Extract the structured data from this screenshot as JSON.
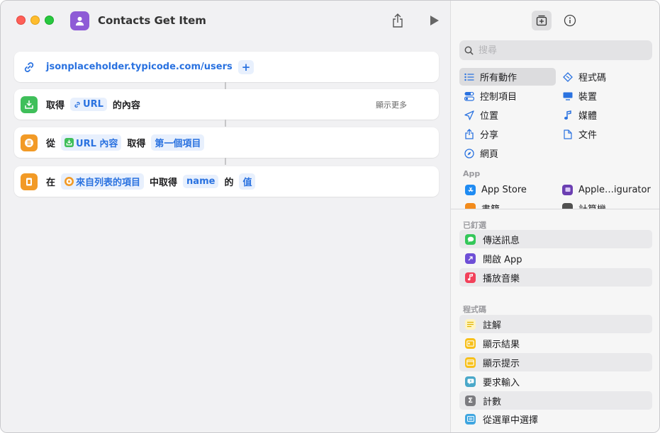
{
  "window": {
    "title": "Contacts Get Item"
  },
  "editor": {
    "actions": [
      {
        "url": "jsonplaceholder.typicode.com/users",
        "plus": "+"
      },
      {
        "verb": "取得",
        "param": "URL",
        "suffix": "的內容",
        "show_more": "顯示更多"
      },
      {
        "from": "從",
        "param": "URL 內容",
        "verb": "取得",
        "value": "第一個項目"
      },
      {
        "in": "在",
        "param": "來自列表的項目",
        "verb": "中取得",
        "key": "name",
        "of": "的",
        "value": "值"
      }
    ]
  },
  "sidebar": {
    "search_placeholder": "搜尋",
    "categories": {
      "all_actions": "所有動作",
      "scripting": "程式碼",
      "controls": "控制項目",
      "device": "裝置",
      "location": "位置",
      "media": "媒體",
      "sharing": "分享",
      "documents": "文件",
      "web": "網頁"
    },
    "app_section": "App",
    "apps": {
      "app_store": "App Store",
      "configurator": "Apple…igurator",
      "books": "書籍",
      "calculator": "計算機"
    },
    "pinned_section": "已釘選",
    "pinned": [
      "傳送訊息",
      "開啟 App",
      "播放音樂"
    ],
    "scripting_section": "程式碼",
    "scripting_actions": [
      "註解",
      "顯示結果",
      "顯示提示",
      "要求輸入",
      "計數",
      "從選單中選擇"
    ]
  },
  "colors": {
    "accent_blue": "#2a72e0",
    "pill_bg": "#e8f0fd",
    "app_icon_purple": "#8e5bd6",
    "green": "#3fbf5a",
    "orange": "#f29a26"
  }
}
